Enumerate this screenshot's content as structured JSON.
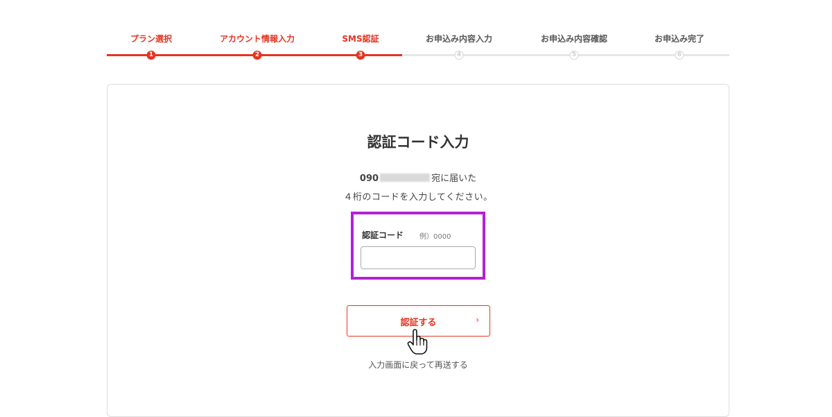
{
  "steps": [
    {
      "label": "プラン選択",
      "number": "1",
      "status": "done"
    },
    {
      "label": "アカウント情報入力",
      "number": "2",
      "status": "done"
    },
    {
      "label": "SMS認証",
      "number": "3",
      "status": "done"
    },
    {
      "label": "お申込み内容入力",
      "number": "4",
      "status": "todo"
    },
    {
      "label": "お申込み内容確認",
      "number": "5",
      "status": "todo"
    },
    {
      "label": "お申込み完了",
      "number": "6",
      "status": "todo"
    }
  ],
  "card": {
    "title": "認証コード入力",
    "phone_prefix": "090",
    "description_suffix": "宛に届いた",
    "description_line2": "４桁のコードを入力してください。",
    "code_label": "認証コード",
    "code_example": "例）0000",
    "code_value": "",
    "verify_button": "認証する",
    "verify_chevron": "›",
    "resend_link": "入力画面に戻って再送する"
  },
  "colors": {
    "accent": "#e8331f",
    "highlight": "#b41fd6",
    "inactive": "#e6e6e6"
  }
}
